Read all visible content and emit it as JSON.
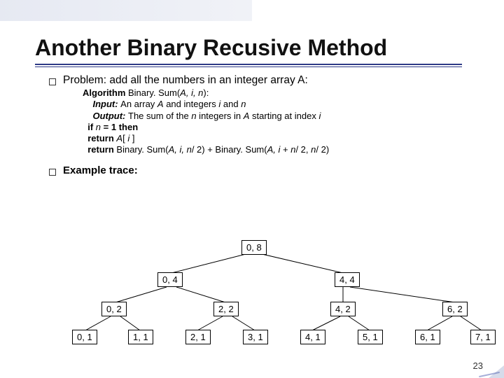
{
  "title": "Another Binary Recusive Method",
  "problem_line": "Problem: add all the numbers in an integer array A:",
  "algo": {
    "l1_pre": "Algorithm",
    "l1_post": " Binary. Sum(",
    "l1_args": "A, i, n",
    "l1_end": "):",
    "l2_label": "Input: ",
    "l2_a": "An array ",
    "l2_b": "A",
    "l2_c": " and integers ",
    "l2_d": "i",
    "l2_e": " and ",
    "l2_f": "n",
    "l3_label": "Output: ",
    "l3_a": "The sum of the ",
    "l3_b": "n",
    "l3_c": " integers in ",
    "l3_d": "A",
    "l3_e": " starting at index ",
    "l3_f": "i",
    "l4_a": "if ",
    "l4_b": "n",
    "l4_c": " = 1 then",
    "l5_a": "return ",
    "l5_b": "A",
    "l5_c": "[ ",
    "l5_d": "i",
    "l5_e": " ]",
    "l6_a": "return",
    "l6_b": " Binary. Sum(",
    "l6_c": "A, i, n",
    "l6_d": "/ 2) + Binary. Sum(",
    "l6_e": "A, i ",
    "l6_f": "+ ",
    "l6_g": "n",
    "l6_h": "/ 2, ",
    "l6_i": "n",
    "l6_j": "/ 2)"
  },
  "example_label": "Example trace:",
  "nodes": {
    "n0": "0, 8",
    "n1": "0, 4",
    "n2": "4, 4",
    "n3": "0, 2",
    "n4": "2, 2",
    "n5": "4, 2",
    "n6": "6, 2",
    "n7": "0, 1",
    "n8": "1, 1",
    "n9": "2, 1",
    "n10": "3, 1",
    "n11": "4, 1",
    "n12": "5, 1",
    "n13": "6, 1",
    "n14": "7, 1"
  },
  "page_number": "23"
}
